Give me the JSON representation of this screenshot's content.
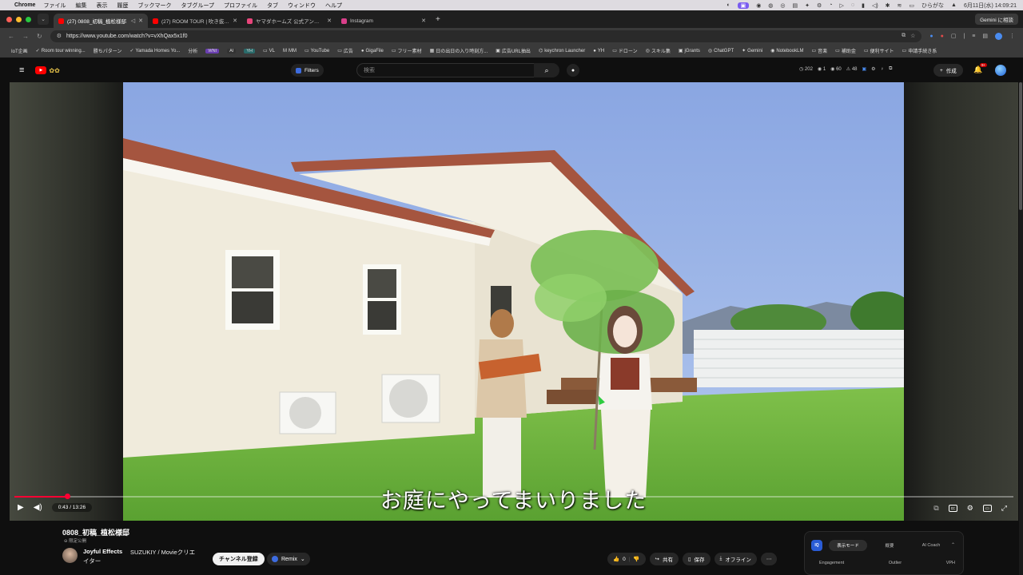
{
  "menubar": {
    "app": "Chrome",
    "items": [
      "ファイル",
      "編集",
      "表示",
      "履歴",
      "ブックマーク",
      "タブグループ",
      "プロファイル",
      "タブ",
      "ウィンドウ",
      "ヘルプ"
    ],
    "input_mode": "ひらがな",
    "datetime": "6月11日(水) 14:09:21"
  },
  "tabs": [
    {
      "title": "(27) 0808_初稿_植松様邸",
      "color": "#ff0000"
    },
    {
      "title": "(27) ROOM TOUR | 吹き抜けの",
      "color": "#ff0000"
    },
    {
      "title": "ヤマダホームズ 公式アンバサダー",
      "color": "#e8457b"
    },
    {
      "title": "Instagram",
      "color": "#d93f8a"
    }
  ],
  "gemini_button": "Gemini に相談",
  "address": {
    "url": "https://www.youtube.com/watch?v=vXhQax5x1f0"
  },
  "bookmarks": [
    {
      "label": "IoT企画",
      "icon": ""
    },
    {
      "label": "Room tour winning...",
      "icon": "✓"
    },
    {
      "label": "勝ちパターン",
      "icon": ""
    },
    {
      "label": "Yamada Homes Yo...",
      "icon": "✓"
    },
    {
      "label": "分析",
      "icon": ""
    },
    {
      "label": "WNI",
      "icon": "",
      "badge": "#6a3fb0"
    },
    {
      "label": "AI",
      "icon": "",
      "badge": "#333"
    },
    {
      "label": "YH",
      "icon": "",
      "badge": "#2a6a6a"
    },
    {
      "label": "VL",
      "icon": "▭"
    },
    {
      "label": "MM",
      "icon": "M"
    },
    {
      "label": "YouTube",
      "icon": "▭"
    },
    {
      "label": "広告",
      "icon": "▭"
    },
    {
      "label": "GigaFile",
      "icon": "●"
    },
    {
      "label": "フリー素材",
      "icon": "▭"
    },
    {
      "label": "日の出日の入り時刻方...",
      "icon": "▦"
    },
    {
      "label": "広告URL抽出",
      "icon": "▣"
    },
    {
      "label": "keychron Launcher",
      "icon": "⌬"
    },
    {
      "label": "YH",
      "icon": "●"
    },
    {
      "label": "ドローン",
      "icon": "▭"
    },
    {
      "label": "スキル集",
      "icon": "◎"
    },
    {
      "label": "jGrants",
      "icon": "▣"
    },
    {
      "label": "ChatGPT",
      "icon": "◎"
    },
    {
      "label": "Gemini",
      "icon": "✦"
    },
    {
      "label": "NotebookLM",
      "icon": "◉"
    },
    {
      "label": "音楽",
      "icon": "▭"
    },
    {
      "label": "補助金",
      "icon": "▭"
    },
    {
      "label": "便利サイト",
      "icon": "▭"
    },
    {
      "label": "申請手続き系",
      "icon": "▭"
    }
  ],
  "youtube": {
    "filters_label": "Filters",
    "search_placeholder": "検索",
    "stats": [
      "202",
      "1",
      "60",
      "48"
    ],
    "create_label": "作成",
    "notif_count": "9+"
  },
  "player": {
    "subtitle": "お庭にやってまいりました",
    "current_time": "0:43",
    "duration": "13:26",
    "time_display": "0:43 / 13:26",
    "progress_fraction": 0.053,
    "accent": "#ff0033"
  },
  "video": {
    "title": "0808_初稿_植松様邸",
    "visibility": "限定公開",
    "channel": "Joyful Effects",
    "channel_desc": "SUZUKIY / Movieクリエ",
    "channel_desc2": "イター",
    "subscribe_label": "チャンネル登録",
    "remix_label": "Remix",
    "likes": "0",
    "share_label": "共有",
    "save_label": "保存",
    "offline_label": "オフライン"
  },
  "panel": {
    "logo": "IQ",
    "tabs": [
      "表示モード",
      "概要",
      "AI Coach"
    ],
    "columns": [
      "Engagement",
      "Outlier",
      "VPH"
    ]
  }
}
